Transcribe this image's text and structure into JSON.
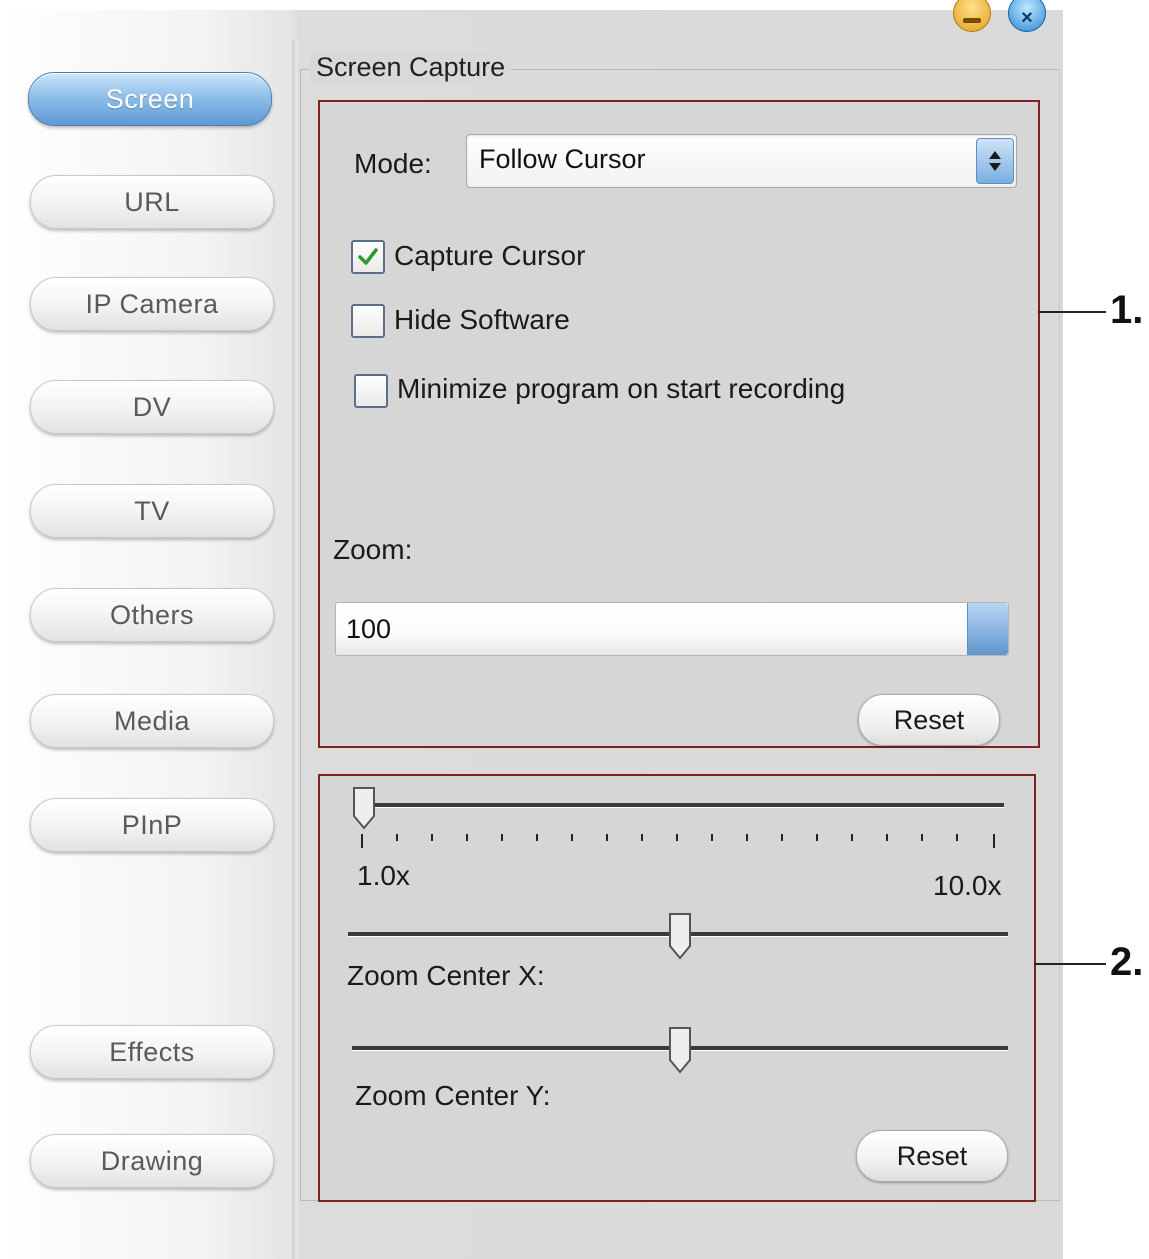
{
  "sidebar": {
    "items": [
      {
        "label": "Screen",
        "active": true
      },
      {
        "label": "URL"
      },
      {
        "label": "IP Camera"
      },
      {
        "label": "DV"
      },
      {
        "label": "TV"
      },
      {
        "label": "Others"
      },
      {
        "label": "Media"
      },
      {
        "label": "PInP"
      },
      {
        "label": "Effects"
      },
      {
        "label": "Drawing"
      }
    ]
  },
  "group_title": "Screen Capture",
  "panel1": {
    "mode_label": "Mode:",
    "mode_value": "Follow Cursor",
    "capture_cursor": {
      "label": "Capture Cursor",
      "checked": true
    },
    "hide_software": {
      "label": "Hide Software",
      "checked": false
    },
    "minimize_program": {
      "label": "Minimize program on start recording",
      "checked": false
    },
    "zoom_label": "Zoom:",
    "zoom_value": "100",
    "reset_label": "Reset"
  },
  "panel2": {
    "zoom_slider": {
      "min_label": "1.0x",
      "max_label": "10.0x",
      "value": 1.0
    },
    "zoom_center_x": {
      "label": "Zoom Center X:",
      "value": 0.5
    },
    "zoom_center_y": {
      "label": "Zoom Center Y:",
      "value": 0.5
    },
    "reset_label": "Reset"
  },
  "callouts": [
    "1.",
    "2."
  ],
  "colors": {
    "panel_border": "#7b2222",
    "active_button": "#5f9ad4",
    "checkmark": "#2a9a2a"
  }
}
